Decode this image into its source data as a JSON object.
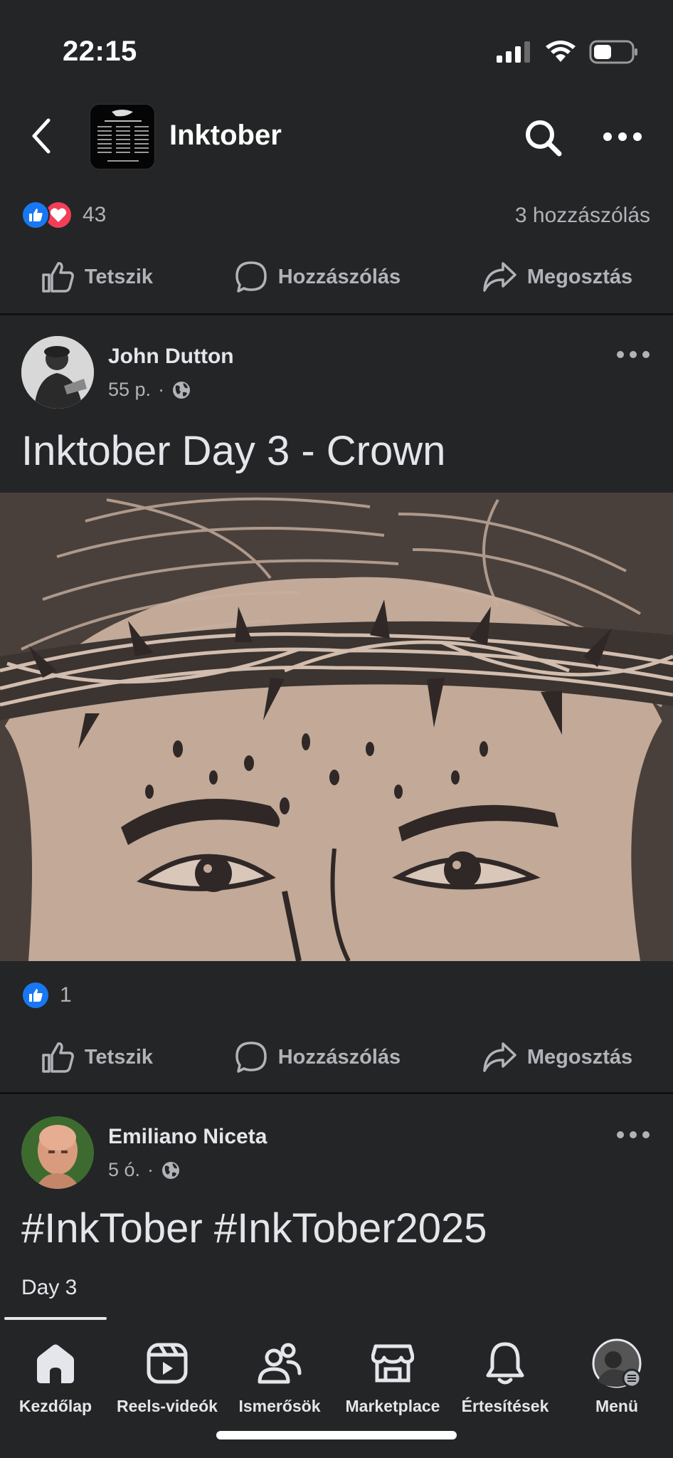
{
  "status_bar": {
    "time": "22:15"
  },
  "header": {
    "title": "Inktober"
  },
  "group_post": {
    "reaction_count": "43",
    "comment_count": "3 hozzászólás"
  },
  "actions": {
    "like": "Tetszik",
    "comment": "Hozzászólás",
    "share": "Megosztás"
  },
  "post1": {
    "author": "John Dutton",
    "time": "55 p.",
    "text": "Inktober Day 3 - Crown",
    "reaction_count": "1"
  },
  "post2": {
    "author": "Emiliano Niceta",
    "time": "5 ó.",
    "text": "#InkTober #InkTober2025",
    "tab": "Day 3"
  },
  "bottom_nav": [
    {
      "label": "Kezdőlap",
      "icon": "home-icon"
    },
    {
      "label": "Reels-videók",
      "icon": "reels-icon"
    },
    {
      "label": "Ismerősök",
      "icon": "friends-icon"
    },
    {
      "label": "Marketplace",
      "icon": "marketplace-icon"
    },
    {
      "label": "Értesítések",
      "icon": "bell-icon"
    },
    {
      "label": "Menü",
      "icon": "profile-menu-icon"
    }
  ],
  "colors": {
    "background": "#242526",
    "like_blue": "#1877f2",
    "love_red": "#f33e58",
    "muted": "#b0b3b8"
  }
}
